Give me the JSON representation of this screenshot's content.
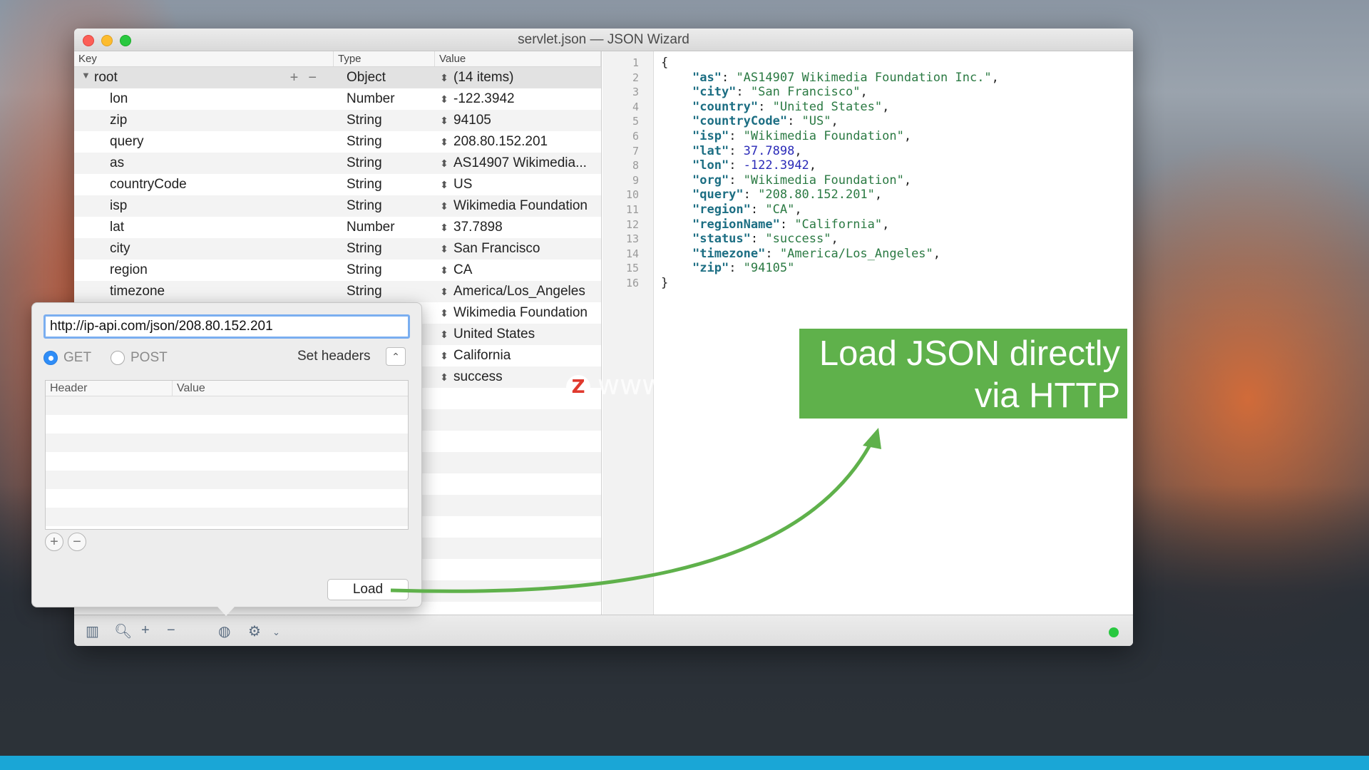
{
  "window": {
    "title": "servlet.json — JSON Wizard"
  },
  "tree": {
    "headers": {
      "key": "Key",
      "type": "Type",
      "value": "Value"
    },
    "root": {
      "key": "root",
      "type": "Object",
      "value": "(14 items)"
    },
    "rows": [
      {
        "key": "lon",
        "type": "Number",
        "value": "-122.3942"
      },
      {
        "key": "zip",
        "type": "String",
        "value": "94105"
      },
      {
        "key": "query",
        "type": "String",
        "value": "208.80.152.201"
      },
      {
        "key": "as",
        "type": "String",
        "value": "AS14907 Wikimedia..."
      },
      {
        "key": "countryCode",
        "type": "String",
        "value": "US"
      },
      {
        "key": "isp",
        "type": "String",
        "value": "Wikimedia Foundation"
      },
      {
        "key": "lat",
        "type": "Number",
        "value": "37.7898"
      },
      {
        "key": "city",
        "type": "String",
        "value": "San Francisco"
      },
      {
        "key": "region",
        "type": "String",
        "value": "CA"
      },
      {
        "key": "timezone",
        "type": "String",
        "value": "America/Los_Angeles"
      },
      {
        "key": "",
        "type": "",
        "value": "Wikimedia Foundation"
      },
      {
        "key": "",
        "type": "",
        "value": "United States"
      },
      {
        "key": "",
        "type": "",
        "value": "California"
      },
      {
        "key": "",
        "type": "",
        "value": "success"
      }
    ]
  },
  "editor": {
    "lines": [
      {
        "n": "1",
        "text": "{"
      },
      {
        "n": "2",
        "k": "\"as\"",
        "v": "\"AS14907 Wikimedia Foundation Inc.\"",
        "vt": "str"
      },
      {
        "n": "3",
        "k": "\"city\"",
        "v": "\"San Francisco\"",
        "vt": "str"
      },
      {
        "n": "4",
        "k": "\"country\"",
        "v": "\"United States\"",
        "vt": "str"
      },
      {
        "n": "5",
        "k": "\"countryCode\"",
        "v": "\"US\"",
        "vt": "str"
      },
      {
        "n": "6",
        "k": "\"isp\"",
        "v": "\"Wikimedia Foundation\"",
        "vt": "str"
      },
      {
        "n": "7",
        "k": "\"lat\"",
        "v": "37.7898",
        "vt": "num"
      },
      {
        "n": "8",
        "k": "\"lon\"",
        "v": "-122.3942",
        "vt": "num"
      },
      {
        "n": "9",
        "k": "\"org\"",
        "v": "\"Wikimedia Foundation\"",
        "vt": "str"
      },
      {
        "n": "10",
        "k": "\"query\"",
        "v": "\"208.80.152.201\"",
        "vt": "str"
      },
      {
        "n": "11",
        "k": "\"region\"",
        "v": "\"CA\"",
        "vt": "str"
      },
      {
        "n": "12",
        "k": "\"regionName\"",
        "v": "\"California\"",
        "vt": "str"
      },
      {
        "n": "13",
        "k": "\"status\"",
        "v": "\"success\"",
        "vt": "str"
      },
      {
        "n": "14",
        "k": "\"timezone\"",
        "v": "\"America/Los_Angeles\"",
        "vt": "str"
      },
      {
        "n": "15",
        "k": "\"zip\"",
        "v": "\"94105\"",
        "vt": "str",
        "last": true
      },
      {
        "n": "16",
        "text": "}"
      }
    ]
  },
  "popover": {
    "url": "http://ip-api.com/json/208.80.152.201",
    "method_get": "GET",
    "method_post": "POST",
    "selected_method": "GET",
    "set_headers_label": "Set headers",
    "header_columns": {
      "header": "Header",
      "value": "Value"
    },
    "load_label": "Load"
  },
  "toolbar": {
    "icons": [
      "columns-icon",
      "search-icon",
      "plus-icon",
      "minus-icon",
      "globe-icon",
      "gear-icon",
      "chevron-down-icon"
    ],
    "status_color": "#29c840"
  },
  "callout": {
    "line1": "Load JSON directly",
    "line2": "via HTTP",
    "color": "#5fb14b"
  },
  "watermark": {
    "logo": "Z",
    "text": "www.MacZ.com"
  }
}
